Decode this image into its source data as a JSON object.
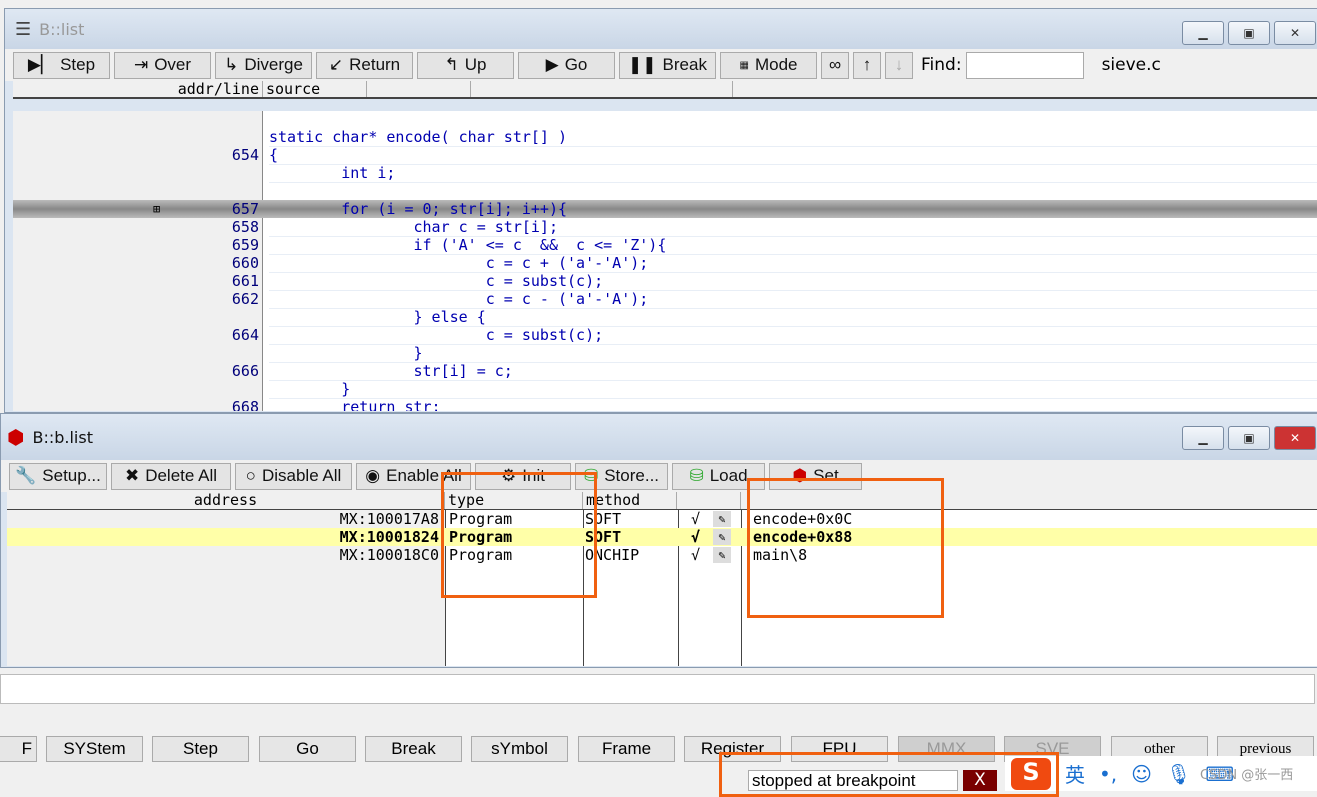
{
  "list_window": {
    "title": "B::list",
    "toolbar": [
      "Step",
      "Over",
      "Diverge",
      "Return",
      "Up",
      "Go",
      "Break",
      "Mode"
    ],
    "find_label": "Find:",
    "find_value": "",
    "file": "sieve.c",
    "columns": [
      "addr/line",
      "source"
    ],
    "code": [
      {
        "n": "",
        "t": "static char* encode( char str[] )"
      },
      {
        "n": "654",
        "t": "{"
      },
      {
        "n": "",
        "t": "        int i;"
      },
      {
        "n": "",
        "t": ""
      },
      {
        "n": "657",
        "t": "        for (i = 0; str[i]; i++){",
        "current": true
      },
      {
        "n": "658",
        "t": "                char c = str[i];"
      },
      {
        "n": "659",
        "t": "                if ('A' <= c  &&  c <= 'Z'){"
      },
      {
        "n": "660",
        "t": "                        c = c + ('a'-'A');"
      },
      {
        "n": "661",
        "t": "                        c = subst(c);"
      },
      {
        "n": "662",
        "t": "                        c = c - ('a'-'A');"
      },
      {
        "n": "",
        "t": "                } else {"
      },
      {
        "n": "664",
        "t": "                        c = subst(c);"
      },
      {
        "n": "",
        "t": "                }"
      },
      {
        "n": "666",
        "t": "                str[i] = c;"
      },
      {
        "n": "",
        "t": "        }"
      },
      {
        "n": "668",
        "t": "        return str;"
      }
    ]
  },
  "blist_window": {
    "title": "B::b.list",
    "toolbar": [
      "Setup...",
      "Delete All",
      "Disable All",
      "Enable All",
      "Init",
      "Store...",
      "Load",
      "Set"
    ],
    "columns": [
      "address",
      "type",
      "method",
      "",
      ""
    ],
    "rows": [
      {
        "address": "MX:100017A8",
        "type": "Program",
        "method": "SOFT",
        "enabled": "√",
        "symbol": "encode+0x0C"
      },
      {
        "address": "MX:10001824",
        "type": "Program",
        "method": "SOFT",
        "enabled": "√",
        "symbol": "encode+0x88",
        "selected": true
      },
      {
        "address": "MX:100018C0",
        "type": "Program",
        "method": "ONCHIP",
        "enabled": "√",
        "symbol": "main\\8"
      }
    ]
  },
  "command_line": "",
  "softkeys": [
    "F",
    "SYStem",
    "Step",
    "Go",
    "Break",
    "sYmbol",
    "Frame",
    "Register",
    "FPU",
    "MMX",
    "SVE",
    "other",
    "previous"
  ],
  "status": {
    "text": "stopped at breakpoint",
    "close": "X"
  },
  "ime": {
    "lang": "英",
    "punct": "•,",
    "watermark": "CSDN @张一西"
  },
  "colors": {
    "annotation": "#f06010",
    "selected_row": "#ffffa8",
    "keyword": "#0000b0",
    "punct": "#e0208c"
  }
}
